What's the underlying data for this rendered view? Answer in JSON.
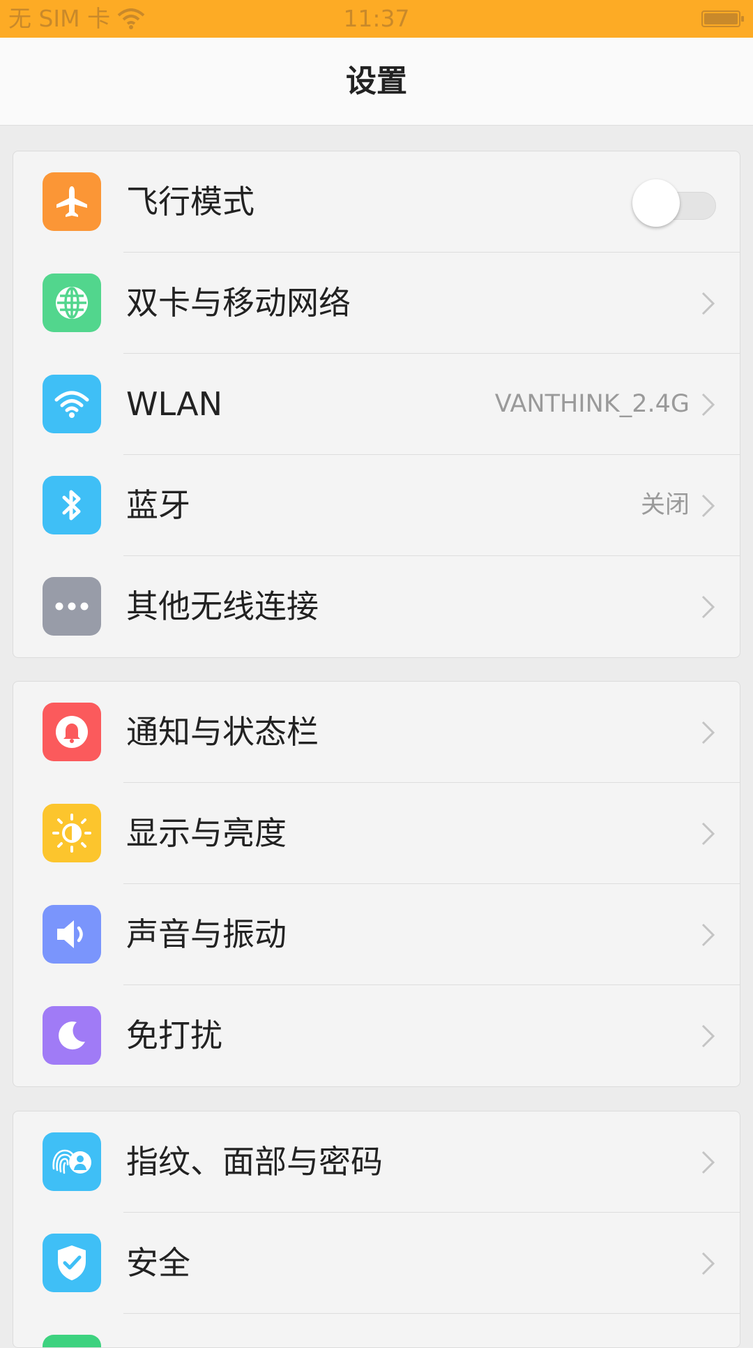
{
  "status_bar": {
    "carrier": "无 SIM 卡",
    "time": "11:37"
  },
  "title": "设置",
  "groups": [
    {
      "items": [
        {
          "label": "飞行模式",
          "icon": "airplane-icon",
          "color": "#fb9636",
          "type": "toggle",
          "toggle_on": false
        },
        {
          "label": "双卡与移动网络",
          "icon": "globe-icon",
          "color": "#52d68d",
          "type": "link"
        },
        {
          "label": "WLAN",
          "icon": "wifi-icon",
          "color": "#3fbff6",
          "type": "link",
          "value": "VANTHINK_2.4G"
        },
        {
          "label": "蓝牙",
          "icon": "bluetooth-icon",
          "color": "#3fbff6",
          "type": "link",
          "value": "关闭"
        },
        {
          "label": "其他无线连接",
          "icon": "more-dots-icon",
          "color": "#989ca8",
          "type": "link"
        }
      ]
    },
    {
      "items": [
        {
          "label": "通知与状态栏",
          "icon": "bell-icon",
          "color": "#fb5a5c",
          "type": "link"
        },
        {
          "label": "显示与亮度",
          "icon": "brightness-icon",
          "color": "#fcc52d",
          "type": "link"
        },
        {
          "label": "声音与振动",
          "icon": "speaker-icon",
          "color": "#7a95fc",
          "type": "link"
        },
        {
          "label": "免打扰",
          "icon": "moon-icon",
          "color": "#a07bf6",
          "type": "link"
        }
      ]
    },
    {
      "items": [
        {
          "label": "指纹、面部与密码",
          "icon": "fingerprint-face-icon",
          "color": "#3fbff6",
          "type": "link"
        },
        {
          "label": "安全",
          "icon": "shield-icon",
          "color": "#3fbff6",
          "type": "link"
        },
        {
          "label": "",
          "icon": "green-icon",
          "color": "#3dd27f",
          "type": "link"
        }
      ]
    }
  ]
}
